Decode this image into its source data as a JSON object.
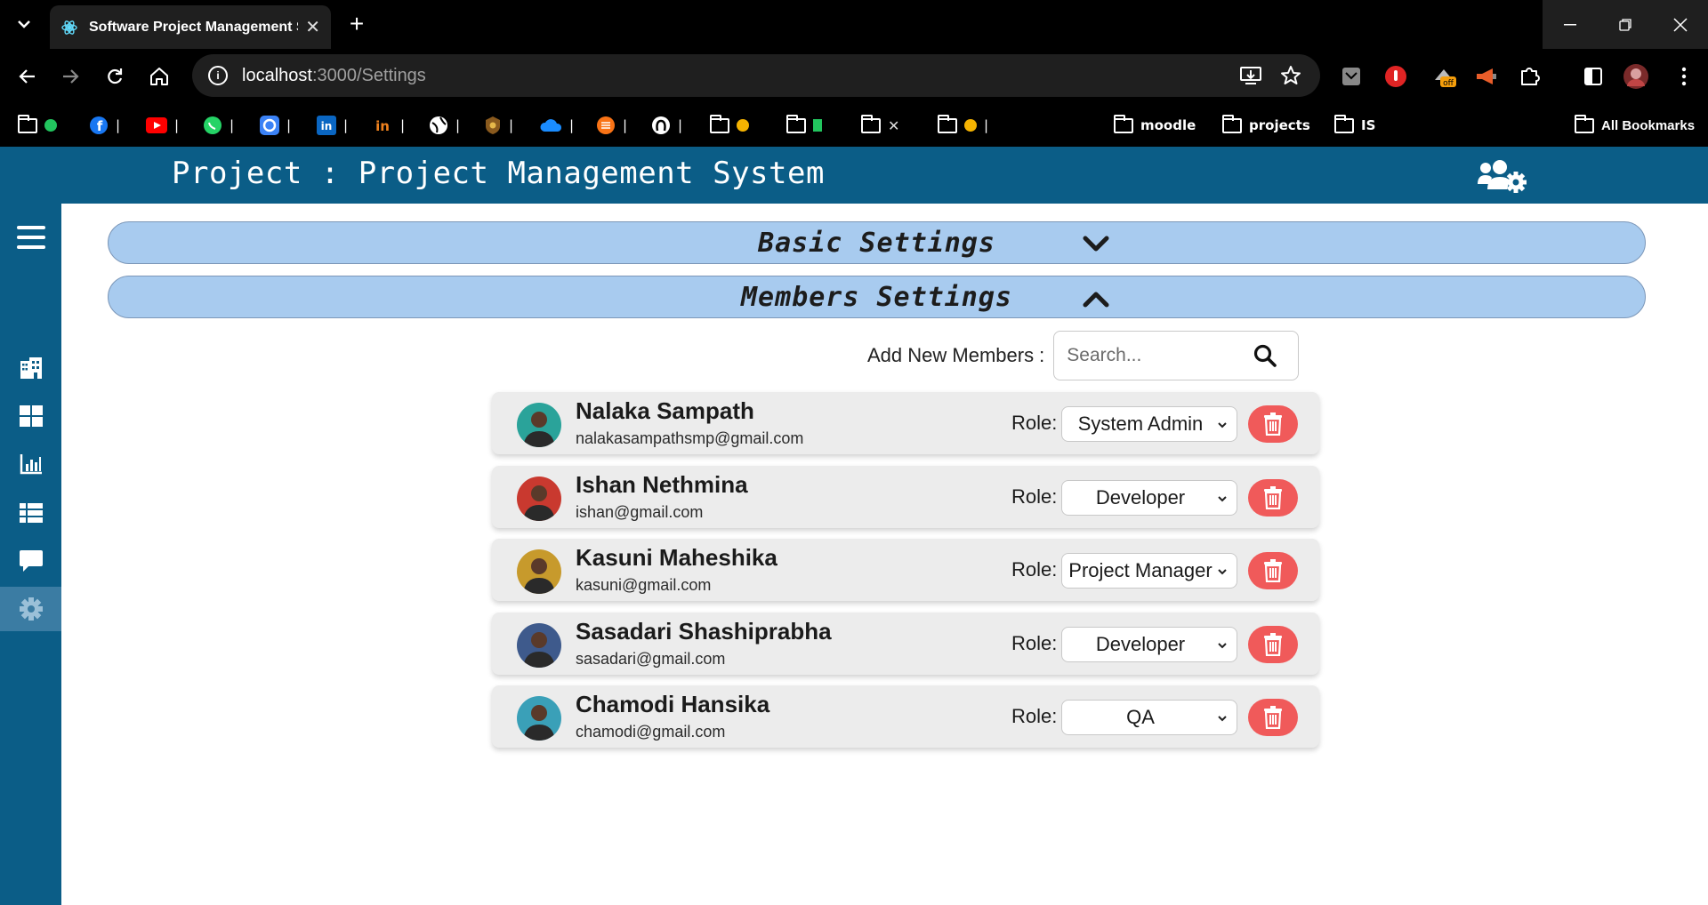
{
  "browser": {
    "tab_title": "Software Project Management Sy",
    "url_host": "localhost",
    "url_path": ":3000/Settings",
    "bookmarks": [
      {
        "label": "moodle"
      },
      {
        "label": "projects"
      },
      {
        "label": "IS"
      },
      {
        "label": "All Bookmarks"
      }
    ]
  },
  "header": {
    "title": "Project : Project Management System"
  },
  "sidebar": {
    "items": [
      {
        "icon": "menu-icon"
      },
      {
        "icon": "building-icon"
      },
      {
        "icon": "dashboard-grid-icon"
      },
      {
        "icon": "bar-chart-icon"
      },
      {
        "icon": "list-icon"
      },
      {
        "icon": "chat-icon"
      },
      {
        "icon": "gear-icon",
        "active": true
      }
    ]
  },
  "settings": {
    "basic_title": "Basic Settings",
    "members_title": "Members Settings",
    "add_members_label": "Add New Members :",
    "search_placeholder": "Search..."
  },
  "members": [
    {
      "name": "Nalaka Sampath",
      "email": "nalakasampathsmp@gmail.com",
      "role_label": "Role:",
      "role": "System Admin",
      "avatar_color": "#2aa39a"
    },
    {
      "name": "Ishan Nethmina",
      "email": "ishan@gmail.com",
      "role_label": "Role:",
      "role": "Developer",
      "avatar_color": "#c9392f"
    },
    {
      "name": "Kasuni Maheshika",
      "email": "kasuni@gmail.com",
      "role_label": "Role:",
      "role": "Project Manager",
      "avatar_color": "#c79a2c"
    },
    {
      "name": "Sasadari Shashiprabha",
      "email": "sasadari@gmail.com",
      "role_label": "Role:",
      "role": "Developer",
      "avatar_color": "#3e5a8c"
    },
    {
      "name": "Chamodi Hansika",
      "email": "chamodi@gmail.com",
      "role_label": "Role:",
      "role": "QA",
      "avatar_color": "#3aa0b8"
    }
  ],
  "colors": {
    "header_bg": "#0b5d87",
    "accordion_bg": "#a8cbef",
    "delete_button": "#f05a5a",
    "card_bg": "#ececec"
  }
}
